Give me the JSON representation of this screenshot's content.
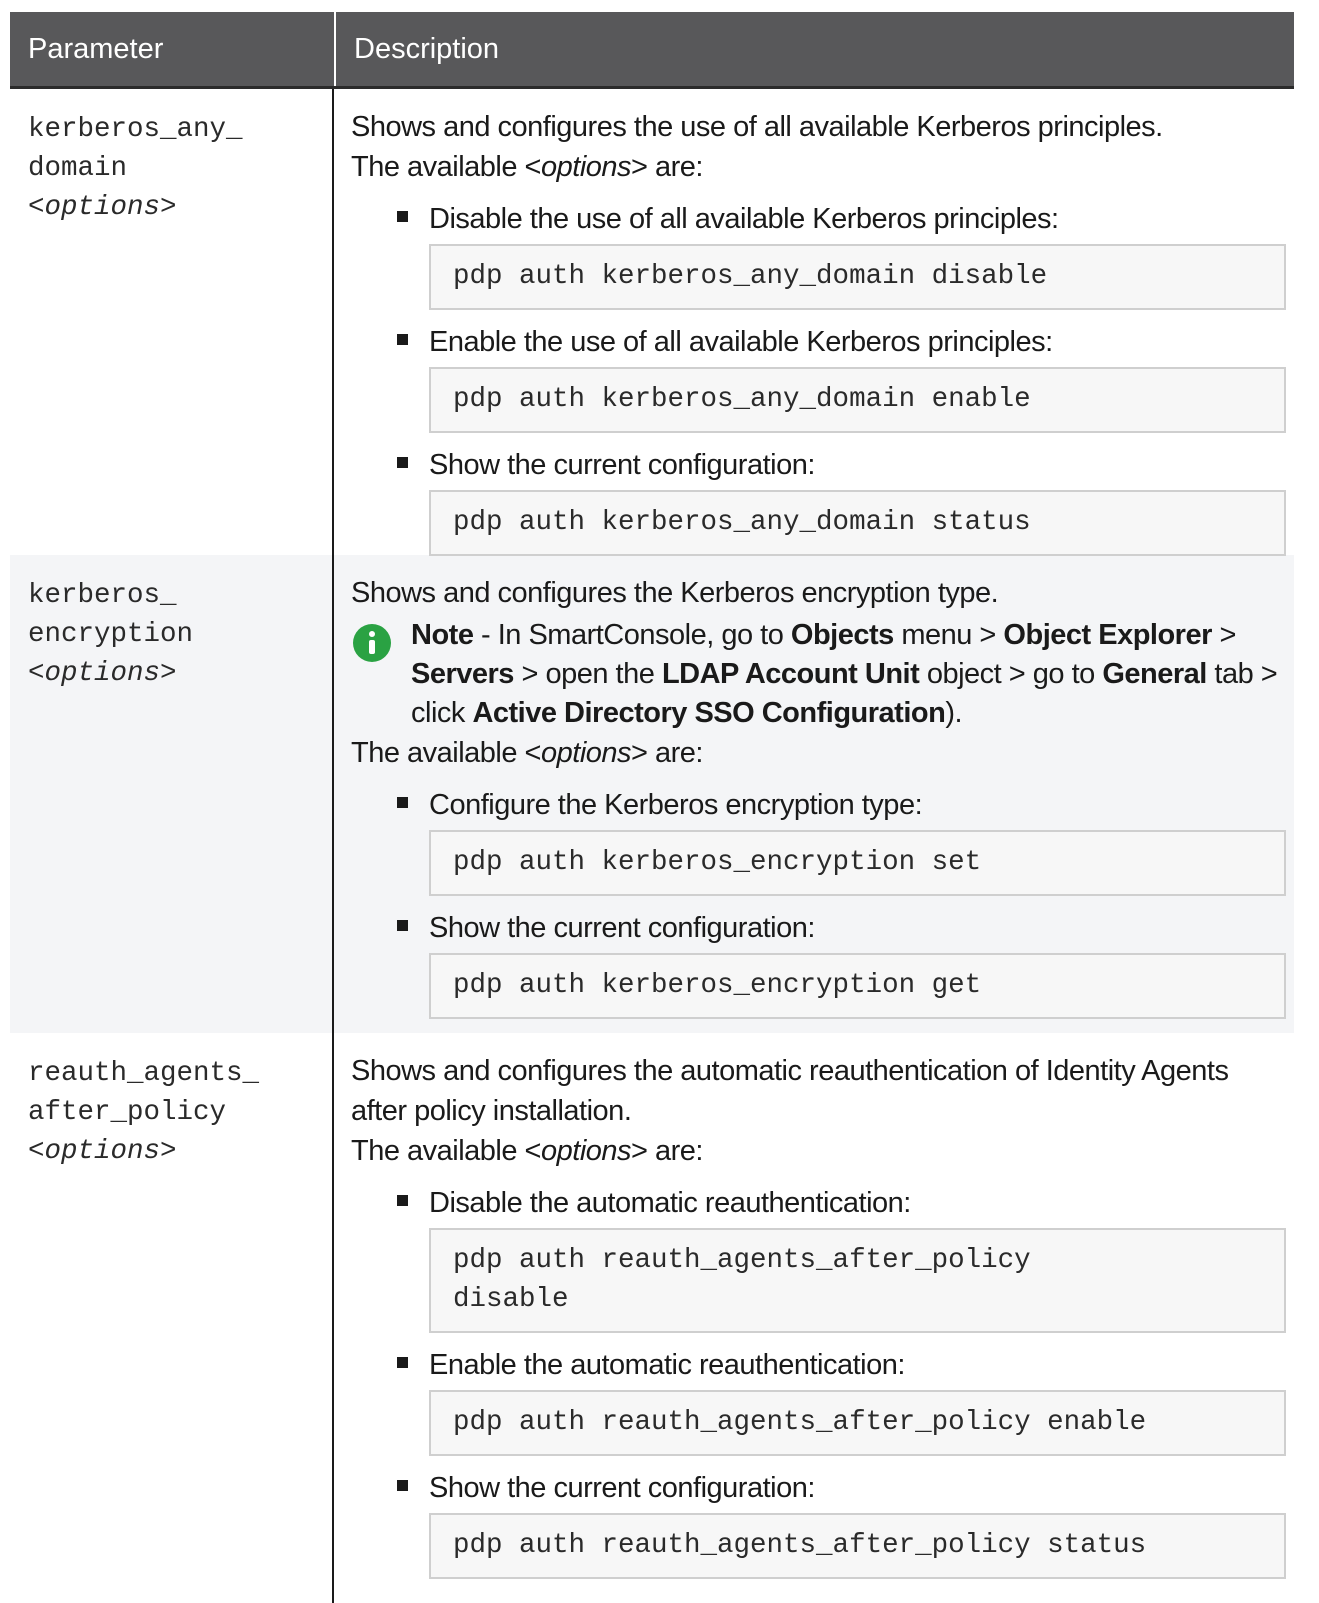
{
  "header": {
    "col_parameter": "Parameter",
    "col_description": "Description"
  },
  "rows": [
    {
      "param_line1": "kerberos_any_",
      "param_line2": "domain",
      "param_opt_open": "<",
      "param_opt": "options",
      "param_opt_close": ">",
      "intro": "Shows and configures the use of all available Kerberos principles.",
      "avail_prefix": "The available <",
      "avail_opt": "options",
      "avail_suffix": "> are:",
      "items": [
        {
          "label": "Disable the use of all available Kerberos principles:",
          "code": "pdp auth kerberos_any_domain disable"
        },
        {
          "label": "Enable the use of all available Kerberos principles:",
          "code": "pdp auth kerberos_any_domain enable"
        },
        {
          "label": "Show the current configuration:",
          "code": "pdp auth kerberos_any_domain status"
        }
      ]
    },
    {
      "param_line1": "kerberos_",
      "param_line2": "encryption",
      "param_opt_open": "<",
      "param_opt": "options",
      "param_opt_close": ">",
      "intro": "Shows and configures the Kerberos encryption type.",
      "note": {
        "icon": "info-icon",
        "t1": "Note",
        "t2": " - In SmartConsole, go to ",
        "t3": "Objects",
        "t4": " menu > ",
        "t5": "Object Explorer",
        "t6": " > ",
        "t7": "Servers",
        "t8": " > open the ",
        "t9": "LDAP Account Unit",
        "t10": " object > go to ",
        "t11": "General",
        "t12": " tab > click ",
        "t13": "Active Directory SSO Configuration",
        "t14": ")."
      },
      "avail_prefix": "The available <",
      "avail_opt": "options",
      "avail_suffix": "> are:",
      "items": [
        {
          "label": "Configure the Kerberos encryption type:",
          "code": "pdp auth kerberos_encryption set"
        },
        {
          "label": "Show the current configuration:",
          "code": "pdp auth kerberos_encryption get"
        }
      ]
    },
    {
      "param_line1": "reauth_agents_",
      "param_line2": "after_policy",
      "param_opt_open": "<",
      "param_opt": "options",
      "param_opt_close": ">",
      "intro": "Shows and configures the automatic reauthentication of Identity Agents after policy installation.",
      "avail_prefix": "The available <",
      "avail_opt": "options",
      "avail_suffix": "> are:",
      "items": [
        {
          "label": "Disable the automatic reauthentication:",
          "code": "pdp auth reauth_agents_after_policy disable"
        },
        {
          "label": "Enable the automatic reauthentication:",
          "code": "pdp auth reauth_agents_after_policy enable"
        },
        {
          "label": "Show the current configuration:",
          "code": "pdp auth reauth_agents_after_policy status"
        }
      ]
    }
  ]
}
